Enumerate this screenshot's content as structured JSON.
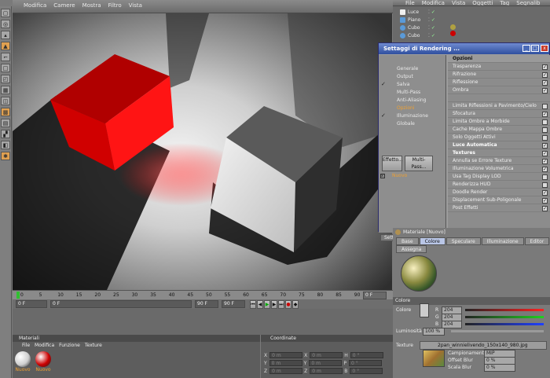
{
  "main_menu": [
    "Modifica",
    "Camere",
    "Mostra",
    "Filtro",
    "Vista"
  ],
  "right_menu": [
    "File",
    "Modifica",
    "Vista",
    "Oggetti",
    "Tag",
    "Segnalib"
  ],
  "objects": [
    {
      "label": "Luce",
      "icon": "light-icon"
    },
    {
      "label": "Piano",
      "icon": "plane-icon"
    },
    {
      "label": "Cubo",
      "icon": "cube-icon"
    },
    {
      "label": "Cubo",
      "icon": "cube-icon"
    }
  ],
  "render_dialog": {
    "title": "Settaggi di Rendering ...",
    "nav": [
      {
        "label": "Generale",
        "checked": false,
        "selected": false
      },
      {
        "label": "Output",
        "checked": false,
        "selected": false
      },
      {
        "label": "Salva",
        "checked": true,
        "selected": false
      },
      {
        "label": "Multi-Pass",
        "checked": false,
        "selected": false
      },
      {
        "label": "Anti-Aliasing",
        "checked": false,
        "selected": false
      },
      {
        "label": "Opzioni",
        "checked": false,
        "selected": true
      },
      {
        "label": "Illuminazione Globale",
        "checked": true,
        "selected": false
      }
    ],
    "effect_button": "Effetto...",
    "multipass_button": "Multi-Pass...",
    "new_item": "Nuovo",
    "footer_tab": "Settaggi di Rendering...",
    "options_header": "Opzioni",
    "options": [
      {
        "label": "Trasparenza",
        "checked": true,
        "header": false
      },
      {
        "label": "Rifrazione",
        "checked": true,
        "header": false
      },
      {
        "label": "Riflessione",
        "checked": true,
        "header": false
      },
      {
        "label": "Ombra",
        "checked": true,
        "header": false
      },
      {
        "label": "",
        "checked": false,
        "header": false
      },
      {
        "label": "Limita Riflessioni a Pavimento/Cielo",
        "checked": false,
        "header": false
      },
      {
        "label": "Sfocatura",
        "checked": true,
        "header": false
      },
      {
        "label": "Limita Ombre a Morbide",
        "checked": false,
        "header": false
      },
      {
        "label": "Cache Mappa Ombre",
        "checked": false,
        "header": false
      },
      {
        "label": "Solo Oggetti Attivi",
        "checked": false,
        "header": false
      },
      {
        "label": "Luce Automatica",
        "checked": true,
        "header": true
      },
      {
        "label": "Textures",
        "checked": true,
        "header": true
      },
      {
        "label": "Annulla se Errore Texture",
        "checked": true,
        "header": false
      },
      {
        "label": "Illuminazione Volumetrica",
        "checked": true,
        "header": false
      },
      {
        "label": "Usa Tag Display LOD",
        "checked": false,
        "header": false
      },
      {
        "label": "Renderizza HUD",
        "checked": false,
        "header": false
      },
      {
        "label": "Doodle Render",
        "checked": true,
        "header": false
      },
      {
        "label": "Displacement Sub-Poligonale",
        "checked": true,
        "header": false
      },
      {
        "label": "Post Effetti",
        "checked": true,
        "header": false
      }
    ]
  },
  "attribute_manager": {
    "material_title": "Materiale [Nuovo]",
    "tabs": [
      {
        "label": "Base",
        "active": false
      },
      {
        "label": "Colore",
        "active": true
      },
      {
        "label": "Speculare",
        "active": false
      },
      {
        "label": "Illuminazione",
        "active": false
      },
      {
        "label": "Editor",
        "active": false
      }
    ],
    "assign_tab": "Assegna",
    "section": "Colore",
    "color_label": "Colore",
    "r_label": "R",
    "g_label": "G",
    "b_label": "B",
    "r_value": "204",
    "g_value": "204",
    "b_value": "204",
    "luminosity_label": "Luminosità",
    "luminosity_value": "100 %",
    "texture_label": "Texture",
    "texture_file": "2pan_winnielivendo_150x140_980.jpg",
    "sampling_label": "Campionamento",
    "sampling_value": "MIP",
    "offset_blur_label": "Offset Blur",
    "offset_blur_value": "0 %",
    "scale_blur_label": "Scala Blur",
    "scale_blur_value": "0 %"
  },
  "timeline": {
    "ticks": [
      "0",
      "5",
      "10",
      "15",
      "20",
      "25",
      "30",
      "35",
      "40",
      "45",
      "50",
      "55",
      "60",
      "65",
      "70",
      "75",
      "80",
      "85",
      "90"
    ],
    "current_frame": "0 F",
    "start_frame": "0 F",
    "end_frame": "90 F",
    "min_frame": "0 F",
    "max_frame": "90 F"
  },
  "materials_panel": {
    "title": "Materiali",
    "menu": [
      "File",
      "Modifica",
      "Funzione",
      "Texture"
    ],
    "items": [
      {
        "label": "Nuovo",
        "color": "#cfcfcf"
      },
      {
        "label": "Nuovo",
        "color": "#cc0000"
      }
    ]
  },
  "coords_panel": {
    "title": "Coordinate",
    "rows": [
      {
        "a": "X",
        "va": "0 m",
        "b": "X",
        "vb": "0 m",
        "c": "H",
        "vc": "0 °"
      },
      {
        "a": "Y",
        "va": "0 m",
        "b": "Y",
        "vb": "0 m",
        "c": "P",
        "vc": "0 °"
      },
      {
        "a": "Z",
        "va": "0 m",
        "b": "Z",
        "vb": "0 m",
        "c": "B",
        "vc": "0 °"
      }
    ]
  },
  "colors": {
    "accent": "#f0a030",
    "red_cube": "#e01010",
    "dialog_title": "#2f4f9f"
  }
}
